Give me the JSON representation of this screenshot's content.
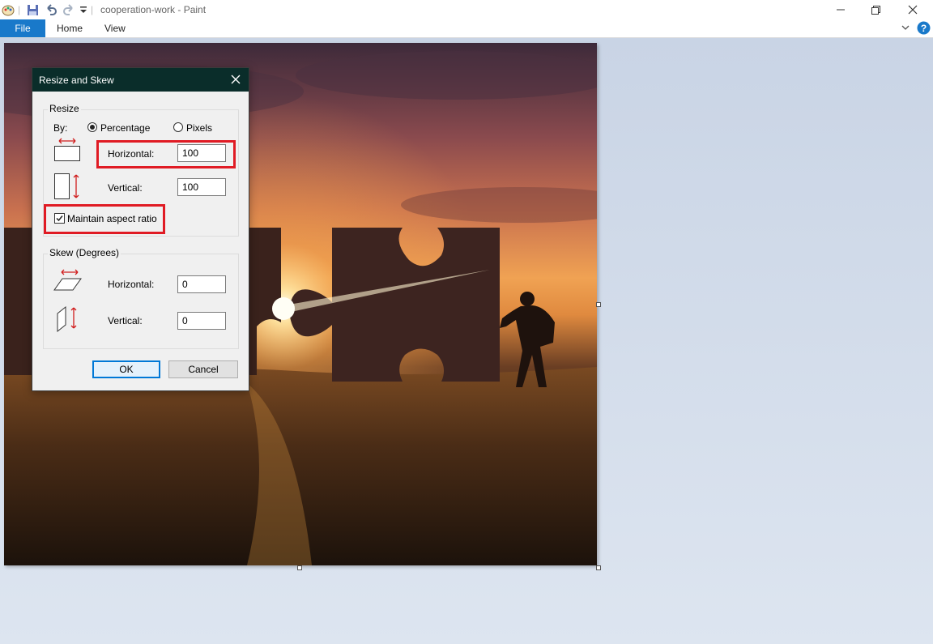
{
  "window": {
    "title": "cooperation-work - Paint"
  },
  "menu": {
    "file": "File",
    "home": "Home",
    "view": "View"
  },
  "dialog": {
    "title": "Resize and Skew",
    "resize": {
      "group_label": "Resize",
      "by_label": "By:",
      "option_percentage": "Percentage",
      "option_pixels": "Pixels",
      "selected": "Percentage",
      "horizontal_label": "Horizontal:",
      "horizontal_value": "100",
      "vertical_label": "Vertical:",
      "vertical_value": "100",
      "maintain_aspect_label": "Maintain aspect ratio",
      "maintain_aspect_checked": true
    },
    "skew": {
      "group_label": "Skew (Degrees)",
      "horizontal_label": "Horizontal:",
      "horizontal_value": "0",
      "vertical_label": "Vertical:",
      "vertical_value": "0"
    },
    "ok_label": "OK",
    "cancel_label": "Cancel"
  },
  "colors": {
    "file_tab": "#1979ca",
    "highlight": "#e01b24",
    "dialog_title_bar": "#0a2d2a"
  }
}
